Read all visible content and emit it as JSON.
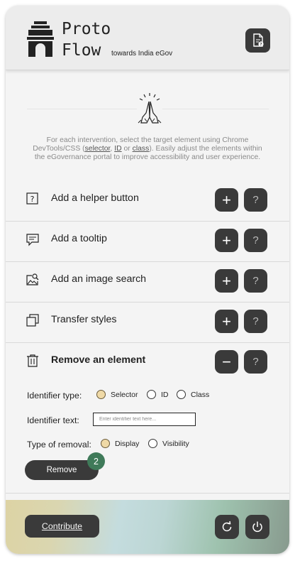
{
  "header": {
    "title_line1": "Proto",
    "title_line2": "Flow",
    "tagline": "towards India eGov",
    "logo_icon": "india-gate-icon",
    "help_icon": "document-help-icon"
  },
  "intro": {
    "hero_icon": "namaste-hands-icon",
    "desc_part1": "For each intervention, select the target element using Chrome DevTools/CSS (",
    "link_selector": "selector",
    "sep1": ", ",
    "link_id": "ID",
    "sep2": " or ",
    "link_class": "class",
    "desc_part2": "). Easily adjust the elements within the eGovernance portal to improve accessibility and user experience."
  },
  "interventions": [
    {
      "label": "Add a helper button",
      "icon": "question-box-icon",
      "action": "+",
      "help": "?"
    },
    {
      "label": "Add a tooltip",
      "icon": "tooltip-icon",
      "action": "+",
      "help": "?"
    },
    {
      "label": "Add an image search",
      "icon": "image-search-icon",
      "action": "+",
      "help": "?"
    },
    {
      "label": "Transfer styles",
      "icon": "copy-icon",
      "action": "+",
      "help": "?"
    },
    {
      "label": "Remove an element",
      "icon": "trash-icon",
      "action": "−",
      "help": "?",
      "expanded": true
    }
  ],
  "remove_form": {
    "identifier_type_label": "Identifier type:",
    "identifier_options": [
      "Selector",
      "ID",
      "Class"
    ],
    "identifier_selected": "Selector",
    "identifier_text_label": "Identifier text:",
    "identifier_text_placeholder": "Enter identifier text here...",
    "identifier_text_value": "",
    "removal_type_label": "Type of removal:",
    "removal_options": [
      "Display",
      "Visibility"
    ],
    "removal_selected": "Display",
    "remove_button": "Remove",
    "badge_count": "2"
  },
  "footer": {
    "contribute_label": "Contribute",
    "reset_icon": "reset-icon",
    "power_icon": "power-icon"
  },
  "colors": {
    "button_dark": "#3a3a3a",
    "radio_selected": "#efd9a6",
    "badge": "#3f7a59"
  }
}
